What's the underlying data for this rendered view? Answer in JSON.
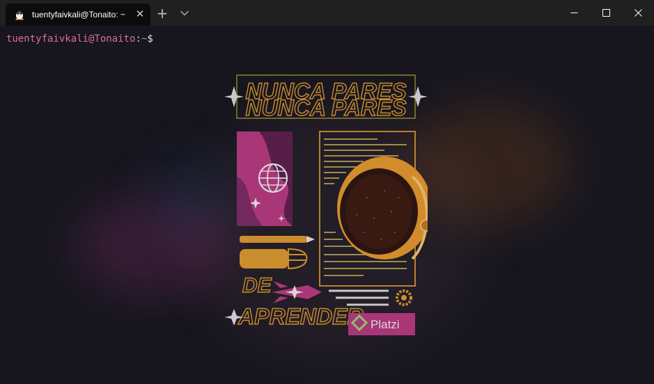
{
  "window": {
    "tab_title": "tuentyfaivkali@Tonaito: ~",
    "tab_icon": "linux-tux-icon",
    "close_glyph": "✕",
    "new_tab_glyph": "+"
  },
  "terminal": {
    "prompt_user_host": "tuentyfaivkali@Tonaito",
    "prompt_colon": ":",
    "prompt_path": "~",
    "prompt_symbol": "$"
  },
  "background_image": {
    "headline_1": "NUNCA PARES",
    "headline_2": "DE",
    "headline_3": "APRENDER",
    "brand": "Platzi"
  },
  "colors": {
    "titlebar": "#202020",
    "tab": "#0c0c0c",
    "terminal_bg": "#17161f",
    "prompt_user": "#e06c9a",
    "prompt_path": "#6fa0e8",
    "accent_orange": "#d9972f",
    "accent_magenta": "#b5397f"
  }
}
